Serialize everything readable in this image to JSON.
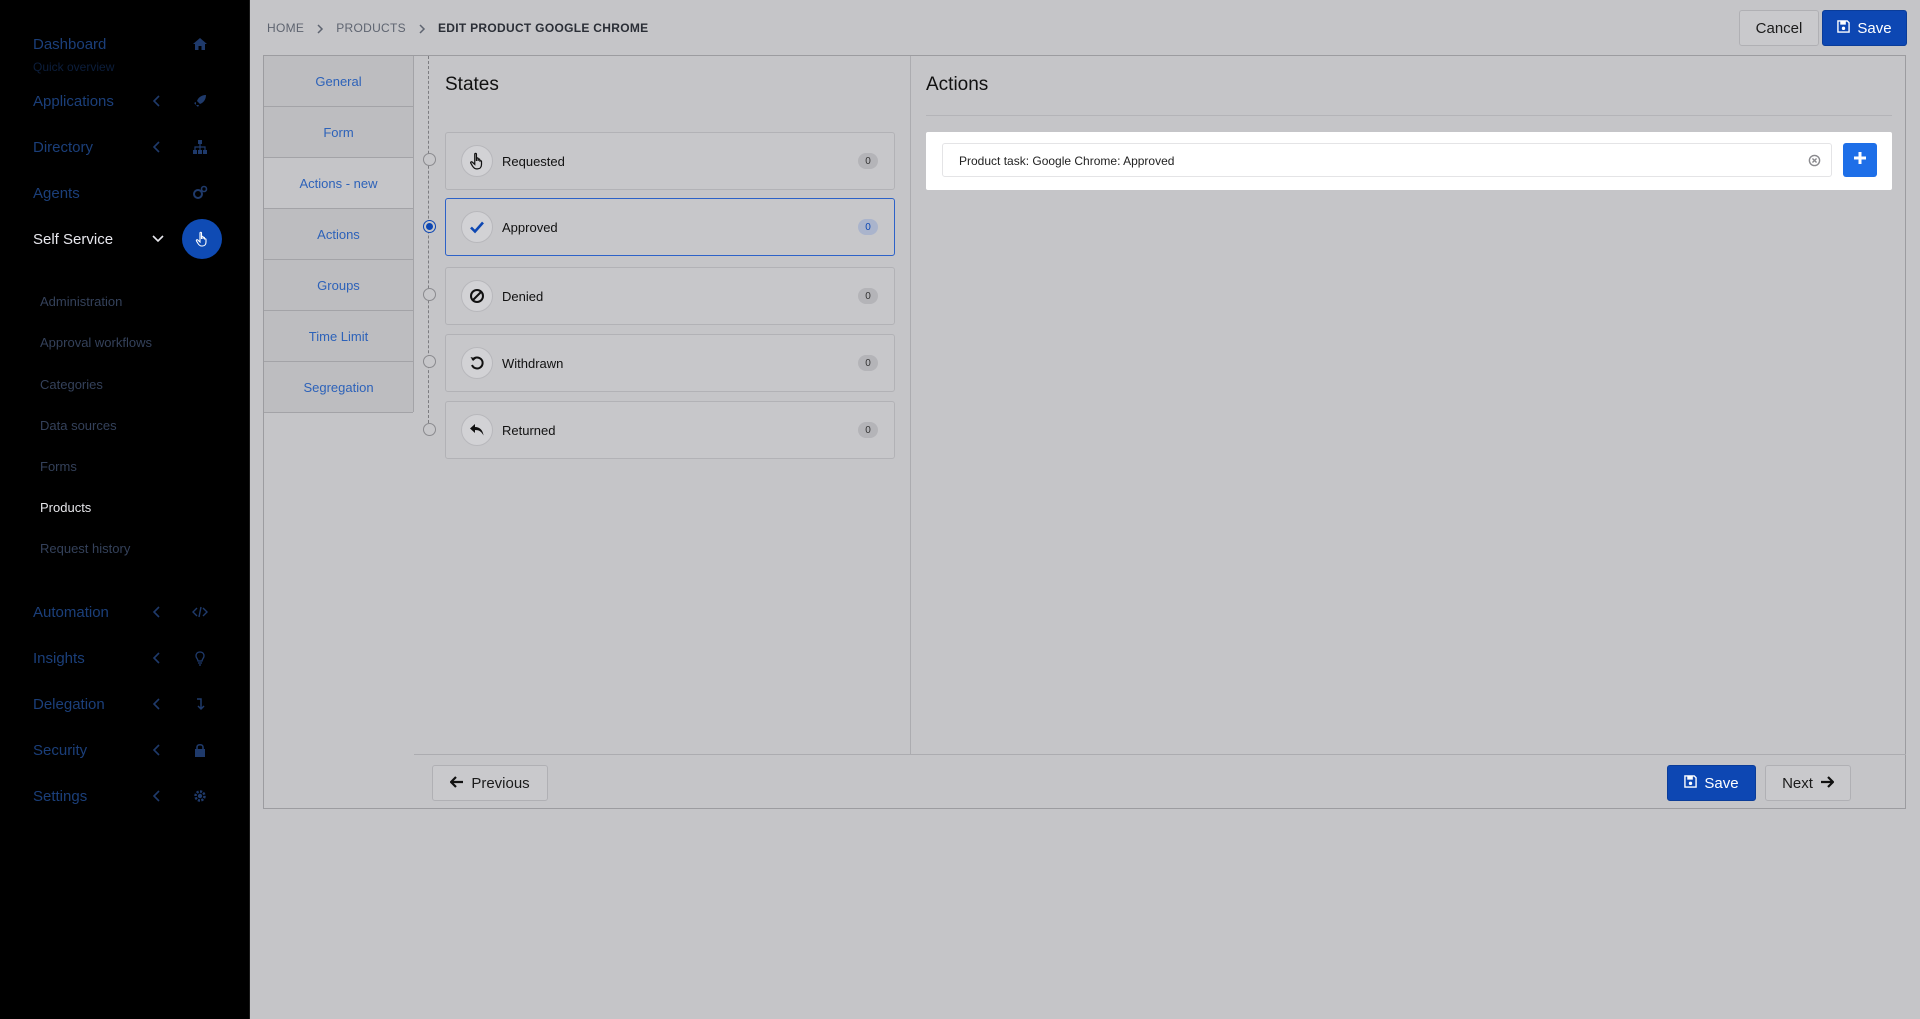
{
  "sidebar": {
    "items": [
      {
        "label": "Dashboard",
        "icon": "home-icon"
      },
      {
        "label": "Applications",
        "icon": "rocket-icon"
      },
      {
        "label": "Directory",
        "icon": "sitemap-icon"
      },
      {
        "label": "Agents",
        "icon": "cogs-icon"
      },
      {
        "label": "Self Service",
        "icon": "hand-pointer-icon"
      },
      {
        "label": "Automation",
        "icon": "code-icon"
      },
      {
        "label": "Insights",
        "icon": "lightbulb-icon"
      },
      {
        "label": "Delegation",
        "icon": "level-down-icon"
      },
      {
        "label": "Security",
        "icon": "lock-icon"
      },
      {
        "label": "Settings",
        "icon": "gear-icon"
      }
    ],
    "dashboard_subtext": "Quick overview",
    "self_service_sub": [
      {
        "label": "Administration"
      },
      {
        "label": "Approval workflows"
      },
      {
        "label": "Categories"
      },
      {
        "label": "Data sources"
      },
      {
        "label": "Forms"
      },
      {
        "label": "Products"
      },
      {
        "label": "Request history"
      }
    ]
  },
  "header": {
    "breadcrumb": {
      "home": "HOME",
      "products": "PRODUCTS",
      "current": "EDIT PRODUCT GOOGLE CHROME"
    },
    "cancel_label": "Cancel",
    "save_label": "Save"
  },
  "tabs": [
    {
      "label": "General"
    },
    {
      "label": "Form"
    },
    {
      "label": "Actions - new"
    },
    {
      "label": "Actions"
    },
    {
      "label": "Groups"
    },
    {
      "label": "Time Limit"
    },
    {
      "label": "Segregation"
    }
  ],
  "active_tab": "Actions - new",
  "states": {
    "title": "States",
    "selected": "Approved",
    "items": [
      {
        "label": "Requested",
        "count": "0",
        "icon": "hand-pointer-icon"
      },
      {
        "label": "Approved",
        "count": "0",
        "icon": "check-icon"
      },
      {
        "label": "Denied",
        "count": "0",
        "icon": "ban-icon"
      },
      {
        "label": "Withdrawn",
        "count": "0",
        "icon": "undo-icon"
      },
      {
        "label": "Returned",
        "count": "0",
        "icon": "reply-icon"
      }
    ]
  },
  "actions": {
    "title": "Actions",
    "items": [
      {
        "label": "Product task: Google Chrome: Approved"
      }
    ]
  },
  "footer": {
    "previous_label": "Previous",
    "save_label": "Save",
    "next_label": "Next"
  },
  "colors": {
    "primary": "#0d47b3",
    "add_button": "#1e6fe8",
    "link": "#2d62b9",
    "sidebar_bg": "#000000",
    "content_bg": "#c5c5c8"
  }
}
